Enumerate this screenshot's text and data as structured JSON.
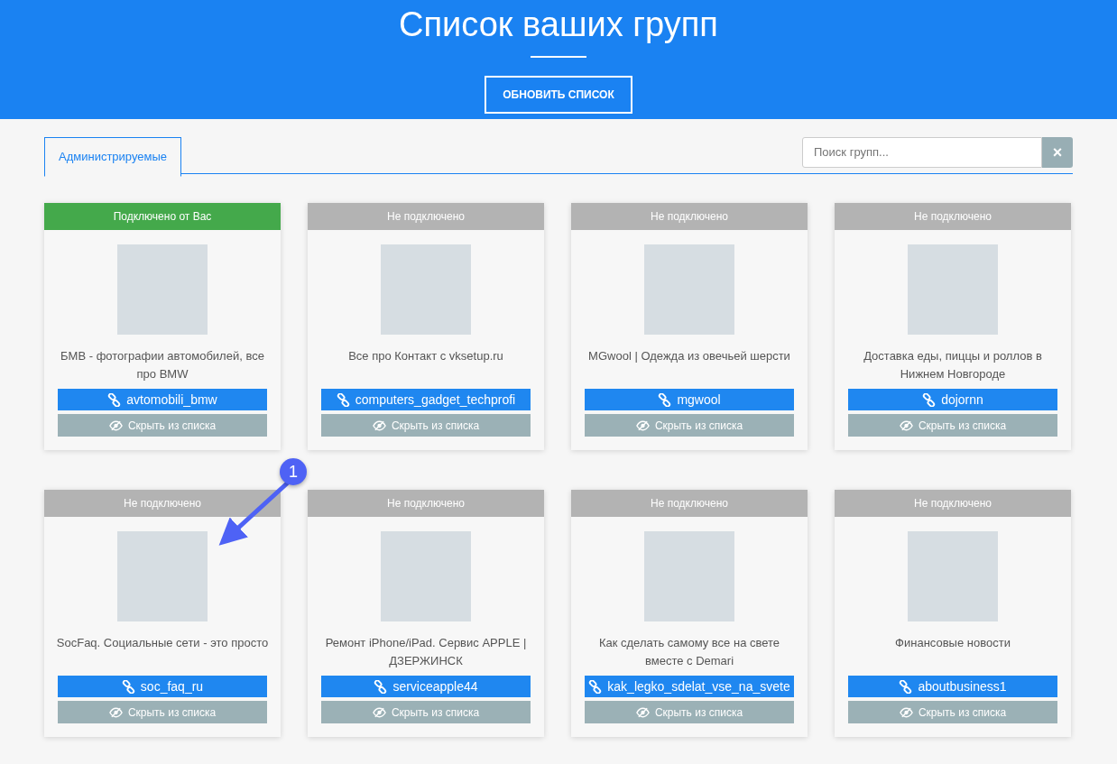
{
  "header": {
    "title": "Список ваших групп",
    "refresh_button": "ОБНОВИТЬ СПИСОК"
  },
  "tabs": [
    {
      "label": "Администрируемые",
      "selected": true
    }
  ],
  "search": {
    "placeholder": "Поиск групп...",
    "clear_button": "×"
  },
  "groups": [
    {
      "status": "Подключено от Вас",
      "connected": true,
      "title": "БМВ - фотографии автомобилей, все про BMW",
      "link": "avtomobili_bmw",
      "hide": "Скрыть из списка"
    },
    {
      "status": "Не подключено",
      "connected": false,
      "title": "Все про Контакт с vksetup.ru",
      "link": "computers_gadget_techprofi",
      "hide": "Скрыть из списка"
    },
    {
      "status": "Не подключено",
      "connected": false,
      "title": "MGwool | Одежда из овечьей шерсти",
      "link": "mgwool",
      "hide": "Скрыть из списка"
    },
    {
      "status": "Не подключено",
      "connected": false,
      "title": "Доставка еды, пиццы и роллов в Нижнем Новгороде",
      "link": "dojornn",
      "hide": "Скрыть из списка"
    },
    {
      "status": "Не подключено",
      "connected": false,
      "title": "SocFaq. Социальные сети - это просто",
      "link": "soc_faq_ru",
      "hide": "Скрыть из списка"
    },
    {
      "status": "Не подключено",
      "connected": false,
      "title": "Ремонт iPhone/iPad. Сервис APPLE | ДЗЕРЖИНСК",
      "link": "serviceapple44",
      "hide": "Скрыть из списка"
    },
    {
      "status": "Не подключено",
      "connected": false,
      "title": "Как сделать самому все на свете вместе с Demari",
      "link": "kak_legko_sdelat_vse_na_svete",
      "hide": "Скрыть из списка"
    },
    {
      "status": "Не подключено",
      "connected": false,
      "title": "Финансовые новости",
      "link": "aboutbusiness1",
      "hide": "Скрыть из списка"
    }
  ],
  "annotation": {
    "label": "1"
  }
}
